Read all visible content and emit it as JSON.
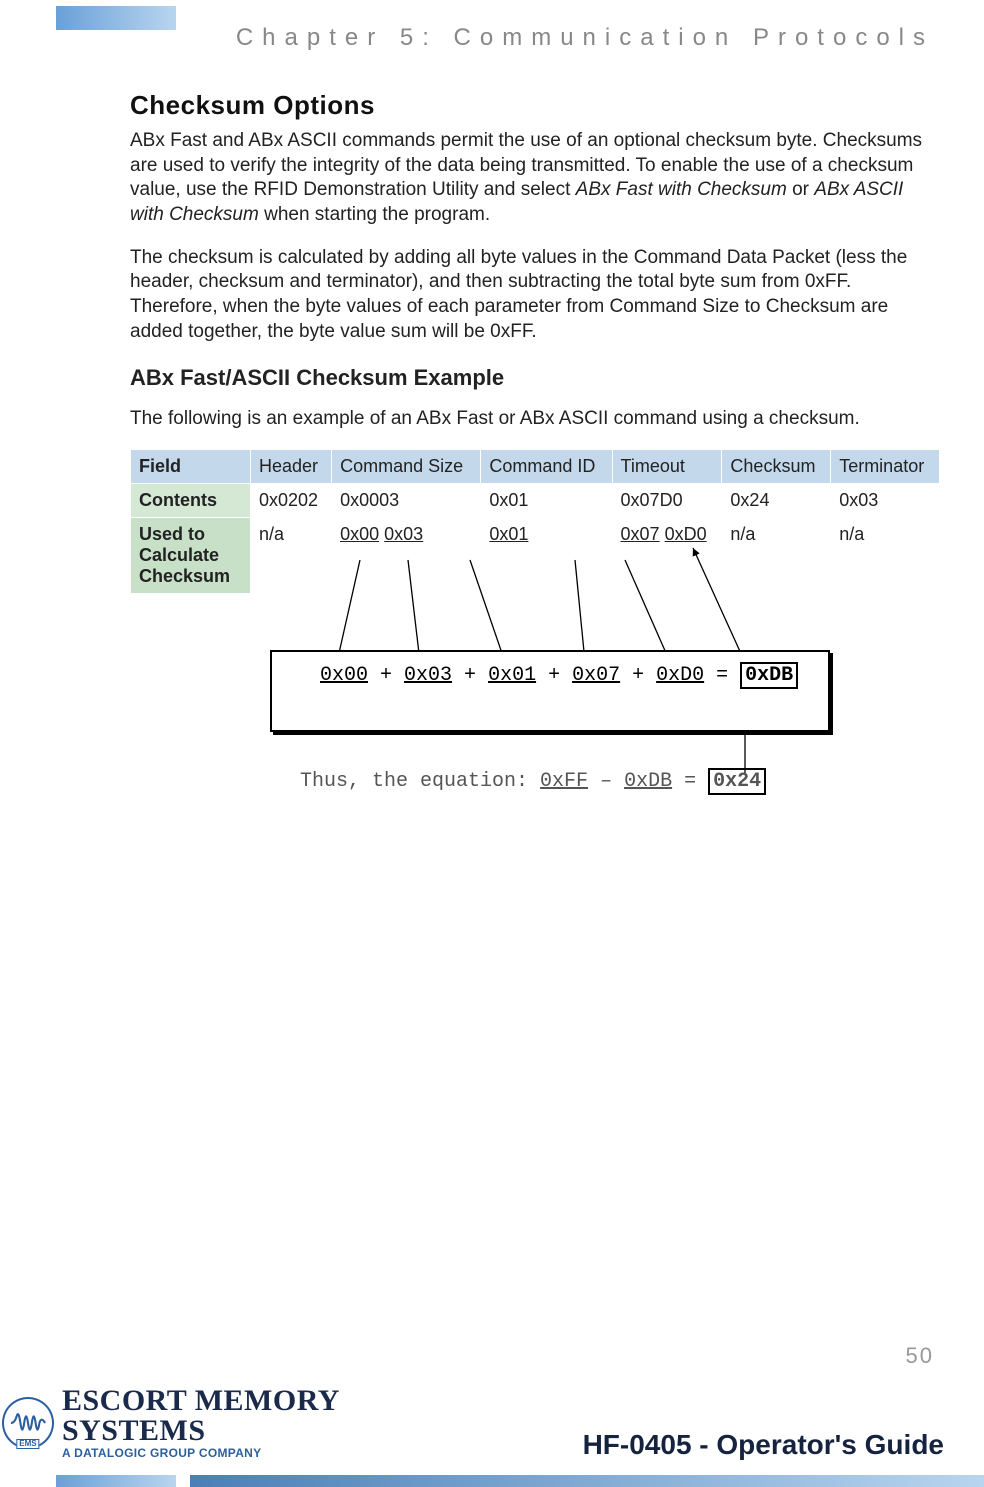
{
  "chapter": "Chapter 5: Communication Protocols",
  "section_title": "Checksum Options",
  "para1_a": "ABx Fast and ABx ASCII commands permit the use of an optional checksum byte. Checksums are used to verify the integrity of the data being transmitted. To enable the use of a checksum value, use the RFID Demonstration Utility and select ",
  "para1_b": "ABx Fast with Checksum ",
  "para1_c": "or ",
  "para1_d": "ABx ASCII with Checksum ",
  "para1_e": "when starting the program.",
  "para2": "The checksum is calculated by adding all byte values in the Command Data Packet (less the header, checksum and terminator), and then subtracting the total byte sum from 0xFF. Therefore, when the byte values of each parameter from Command Size to Checksum are added together, the byte value sum will be 0xFF.",
  "example_heading": "ABx Fast/ASCII Checksum Example",
  "para3": "The following is an example of an ABx Fast or ABx ASCII command using a checksum.",
  "table": {
    "row1_label": "Field",
    "row1": [
      "Header",
      "Command Size",
      "Command ID",
      "Timeout",
      "Checksum",
      "Terminator"
    ],
    "row2_label": "Contents",
    "row2": [
      "0x0202",
      "0x0003",
      "0x01",
      "0x07D0",
      "0x24",
      "0x03"
    ],
    "row3_label": "Used to Calculate Checksum",
    "row3_c1": "n/a",
    "row3_c2a": "0x00",
    "row3_c2b": "0x03",
    "row3_c3": "0x01",
    "row3_c4a": "0x07",
    "row3_c4b": "0xD0",
    "row3_c5": "n/a",
    "row3_c6": "n/a"
  },
  "sum_parts": {
    "a": "0x00",
    "b": "0x03",
    "c": "0x01",
    "d": "0x07",
    "e": "0xD0",
    "plus": " + ",
    "eq": " = ",
    "result": "0xDB"
  },
  "equation": {
    "prefix": "Thus, the equation: ",
    "a": "0xFF",
    "minus": " – ",
    "b": "0xDB",
    "eq": " = ",
    "result": "0x24"
  },
  "page_number": "50",
  "footer": {
    "logo_main": "ESCORT MEMORY SYSTEMS",
    "logo_sub": "A DATALOGIC GROUP COMPANY",
    "badge": "EMS",
    "guide": "HF-0405 - Operator's Guide"
  }
}
